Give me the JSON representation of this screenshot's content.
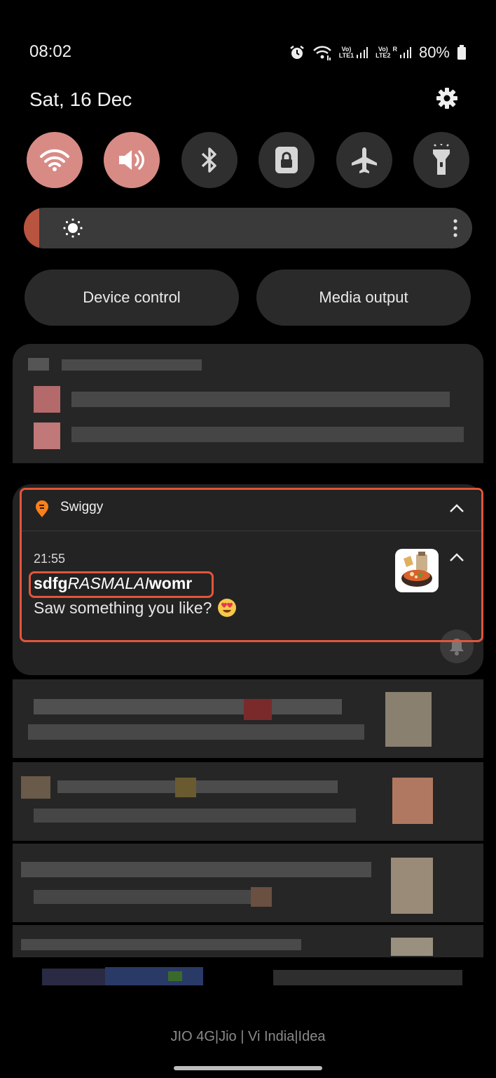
{
  "status_bar": {
    "time": "08:02",
    "sim1_label_top": "Vo)",
    "sim1_label_bottom": "LTE1",
    "sim2_label_top": "Vo)",
    "sim2_label_bottom": "LTE2",
    "sim2_roaming": "R",
    "battery": "80%"
  },
  "header": {
    "date": "Sat, 16 Dec"
  },
  "quick_tiles": [
    {
      "name": "wifi",
      "icon": "wifi-icon",
      "active": true
    },
    {
      "name": "sound",
      "icon": "volume-icon",
      "active": true
    },
    {
      "name": "bluetooth",
      "icon": "bluetooth-icon",
      "active": false
    },
    {
      "name": "rotation-lock",
      "icon": "lock-icon",
      "active": false
    },
    {
      "name": "airplane",
      "icon": "airplane-icon",
      "active": false
    },
    {
      "name": "flashlight",
      "icon": "flashlight-icon",
      "active": false
    }
  ],
  "controls": {
    "device_control": "Device control",
    "media_output": "Media output"
  },
  "notification": {
    "app_name": "Swiggy",
    "time": "21:55",
    "title_prefix": "sdfg",
    "title_italic": "RASMALAI",
    "title_suffix": "womr",
    "body": "Saw something you like?",
    "emoji": "😍"
  },
  "footer": {
    "carrier": "JIO 4G|Jio | Vi India|Idea"
  },
  "colors": {
    "tile_active": "#d88b85",
    "tile_inactive": "#2f2f2f",
    "highlight": "#e2553a",
    "swiggy_orange": "#fc8019"
  }
}
